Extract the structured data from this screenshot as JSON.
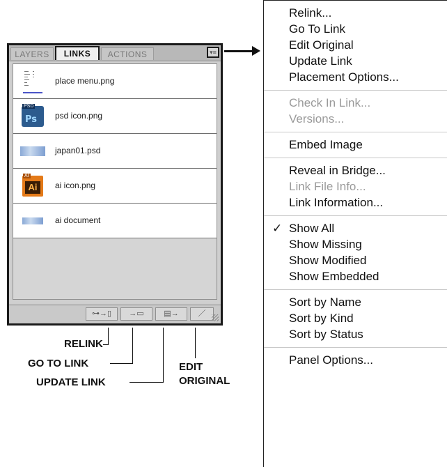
{
  "panel": {
    "tabs": [
      {
        "label": "LAYERS",
        "active": false
      },
      {
        "label": "LINKS",
        "active": true
      },
      {
        "label": "ACTIONS",
        "active": false
      }
    ],
    "menu_icon": "panel-menu-icon",
    "links": [
      {
        "name": "place menu.png",
        "thumb": "menu-screenshot-thumbnail"
      },
      {
        "name": "psd icon.png",
        "thumb": "photoshop-icon-thumbnail"
      },
      {
        "name": "japan01.psd",
        "thumb": "image-thumbnail"
      },
      {
        "name": "ai icon.png",
        "thumb": "illustrator-icon-thumbnail"
      },
      {
        "name": "ai document",
        "thumb": "image-thumbnail"
      }
    ],
    "toolbar": {
      "relink_icon": "relink-icon",
      "goto_icon": "go-to-link-icon",
      "update_icon": "update-link-icon",
      "edit_icon": "edit-original-icon"
    }
  },
  "callouts": {
    "relink": "RELINK",
    "go_to_link": "GO TO LINK",
    "update_link": "UPDATE LINK",
    "edit_original_line1": "EDIT",
    "edit_original_line2": "ORIGINAL"
  },
  "menu": {
    "groups": [
      {
        "items": [
          {
            "label": "Relink...",
            "enabled": true,
            "checked": false
          },
          {
            "label": "Go To Link",
            "enabled": true,
            "checked": false
          },
          {
            "label": "Edit Original",
            "enabled": true,
            "checked": false
          },
          {
            "label": "Update Link",
            "enabled": true,
            "checked": false
          },
          {
            "label": "Placement Options...",
            "enabled": true,
            "checked": false
          }
        ]
      },
      {
        "items": [
          {
            "label": "Check In Link...",
            "enabled": false,
            "checked": false
          },
          {
            "label": "Versions...",
            "enabled": false,
            "checked": false
          }
        ]
      },
      {
        "items": [
          {
            "label": "Embed Image",
            "enabled": true,
            "checked": false
          }
        ]
      },
      {
        "items": [
          {
            "label": "Reveal in Bridge...",
            "enabled": true,
            "checked": false
          },
          {
            "label": "Link File Info...",
            "enabled": false,
            "checked": false
          },
          {
            "label": "Link Information...",
            "enabled": true,
            "checked": false
          }
        ]
      },
      {
        "items": [
          {
            "label": "Show All",
            "enabled": true,
            "checked": true
          },
          {
            "label": "Show Missing",
            "enabled": true,
            "checked": false
          },
          {
            "label": "Show Modified",
            "enabled": true,
            "checked": false
          },
          {
            "label": "Show Embedded",
            "enabled": true,
            "checked": false
          }
        ]
      },
      {
        "items": [
          {
            "label": "Sort by Name",
            "enabled": true,
            "checked": false
          },
          {
            "label": "Sort by Kind",
            "enabled": true,
            "checked": false
          },
          {
            "label": "Sort by Status",
            "enabled": true,
            "checked": false
          }
        ]
      },
      {
        "items": [
          {
            "label": "Panel Options...",
            "enabled": true,
            "checked": false
          }
        ]
      }
    ],
    "check_glyph": "✓"
  }
}
